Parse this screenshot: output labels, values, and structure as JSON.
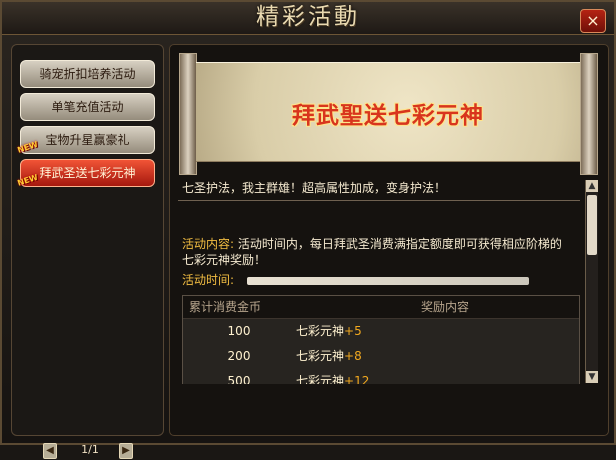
{
  "window": {
    "title": "精彩活動",
    "close_label": "×"
  },
  "sidebar": {
    "items": [
      {
        "label": "骑宠折扣培养活动",
        "badge": ""
      },
      {
        "label": "单笔充值活动",
        "badge": ""
      },
      {
        "label": "宝物升星赢豪礼",
        "badge": "NEW"
      },
      {
        "label": "拜武圣送七彩元神",
        "badge": "NEW"
      }
    ],
    "page": "1/1",
    "prev": "◀",
    "next": "▶"
  },
  "banner": {
    "title": "拜武聖送七彩元神"
  },
  "content": {
    "intro": "七圣护法，我主群雄！超高属性加成，变身护法！",
    "activity_label": "活动内容:",
    "activity_text": "活动时间内，每日拜武圣消费满指定额度即可获得相应阶梯的七彩元神奖励！",
    "time_label": "活动时间:",
    "table_headers": [
      "累计消费金币",
      "奖励内容"
    ],
    "rows": [
      {
        "amount": "100",
        "reward": "七彩元神",
        "bonus": "+5"
      },
      {
        "amount": "200",
        "reward": "七彩元神",
        "bonus": "+8"
      },
      {
        "amount": "500",
        "reward": "七彩元神",
        "bonus": "+12"
      }
    ]
  },
  "colors": {
    "accent": "#f2bd42",
    "active_item": "#d8351d"
  }
}
